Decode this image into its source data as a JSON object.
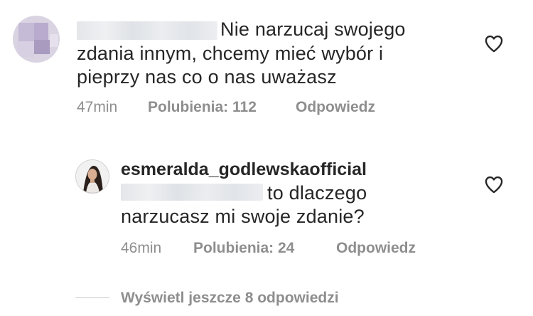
{
  "comment1": {
    "text_line1": "Nie narzucaj swojego",
    "text_line2": "zdania innym, chcemy mieć wybór i",
    "text_line3": "pieprzy nas co o nas uważasz",
    "time": "47min",
    "likes": "Polubienia: 112",
    "reply": "Odpowiedz"
  },
  "comment2": {
    "username": "esmeralda_godlewskaofficial",
    "text_line1": "to dlaczego",
    "text_line2": "narzucasz mi swoje zdanie?",
    "time": "46min",
    "likes": "Polubienia: 24",
    "reply": "Odpowiedz"
  },
  "view_more": "Wyświetl jeszcze 8 odpowiedzi",
  "icons": {
    "like": "heart-outline-icon"
  },
  "colors": {
    "text": "#262626",
    "secondary": "#8e8e8e"
  }
}
